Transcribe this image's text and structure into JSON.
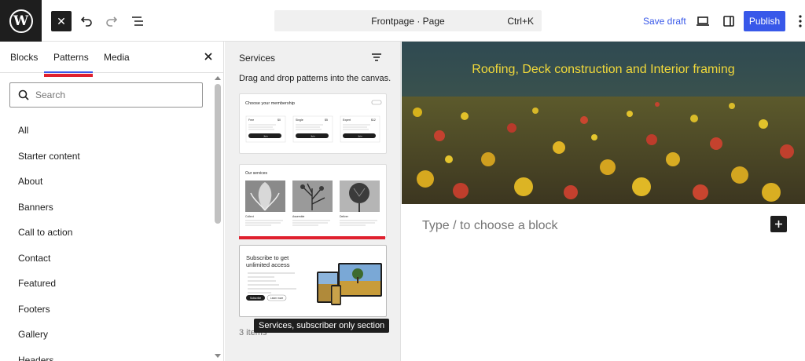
{
  "topbar": {
    "close_inserter_glyph": "✕",
    "document_title": "Frontpage · Page",
    "shortcut": "Ctrl+K",
    "save_draft": "Save draft",
    "publish": "Publish",
    "accent_color": "#3858e9"
  },
  "inserter": {
    "tabs": [
      "Blocks",
      "Patterns",
      "Media"
    ],
    "active_tab": "Patterns",
    "search_placeholder": "Search",
    "categories": [
      "All",
      "Starter content",
      "About",
      "Banners",
      "Call to action",
      "Contact",
      "Featured",
      "Footers",
      "Gallery",
      "Headers"
    ]
  },
  "patterns_panel": {
    "title": "Services",
    "description": "Drag and drop patterns into the canvas.",
    "count": "3 items",
    "tooltip": "Services, subscriber only section",
    "card1": {
      "heading": "Choose your membership",
      "plans": [
        {
          "name": "Free",
          "price": "$0"
        },
        {
          "name": "Single",
          "price": "$5"
        },
        {
          "name": "Expert",
          "price": "$12"
        }
      ],
      "button": "Join"
    },
    "card2": {
      "heading": "Our services",
      "items": [
        "Collect",
        "Assemble",
        "Deliver"
      ]
    },
    "card3": {
      "heading": "Subscribe to get unlimited access",
      "button_primary": "Subscribe",
      "button_secondary": "Learn more"
    }
  },
  "canvas": {
    "cover_text": "Roofing, Deck construction and Interior framing",
    "cover_text_color": "#f2d93a",
    "placeholder": "Type / to choose a block"
  }
}
